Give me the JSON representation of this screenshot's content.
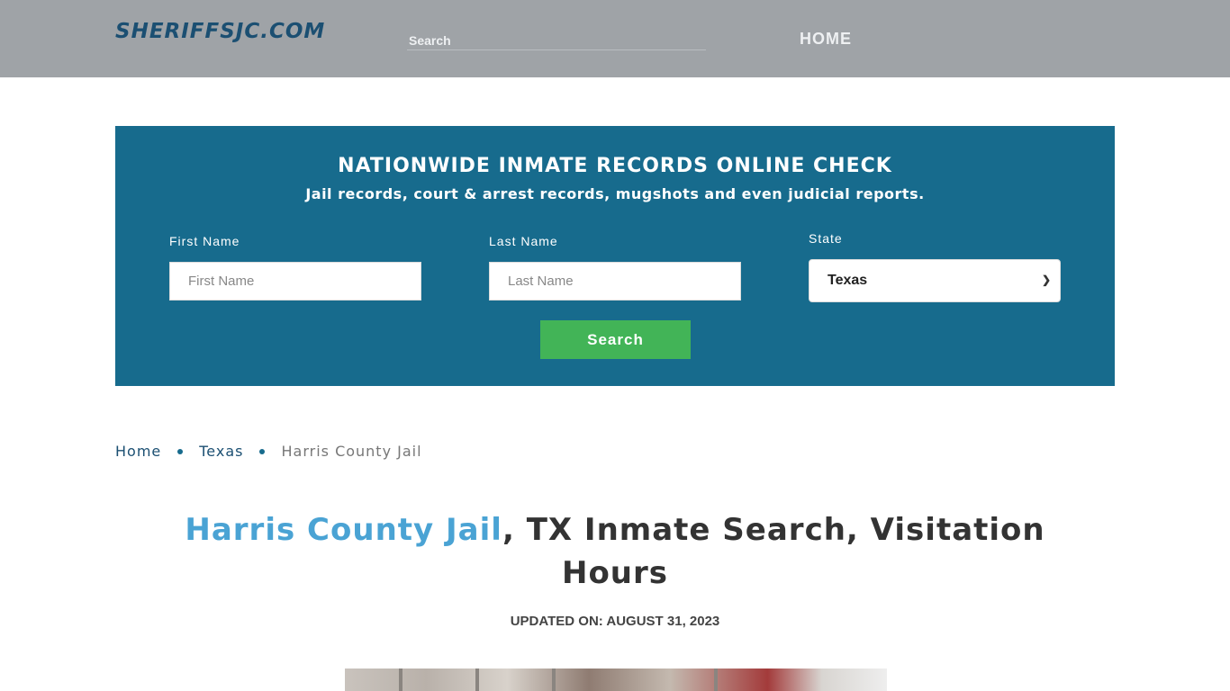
{
  "header": {
    "logo_text": "SHERIFFSJC.COM",
    "search_placeholder": "Search",
    "nav_home": "HOME"
  },
  "search_panel": {
    "title": "NATIONWIDE INMATE RECORDS ONLINE CHECK",
    "subtitle": "Jail records, court & arrest records, mugshots and even judicial reports.",
    "first_name_label": "First Name",
    "first_name_placeholder": "First Name",
    "last_name_label": "Last Name",
    "last_name_placeholder": "Last Name",
    "state_label": "State",
    "state_value": "Texas",
    "search_button": "Search"
  },
  "breadcrumb": {
    "home": "Home",
    "state": "Texas",
    "current": "Harris County Jail"
  },
  "article": {
    "title_highlight": "Harris County Jail",
    "title_rest": ", TX Inmate Search, Visitation Hours",
    "updated": "UPDATED ON: AUGUST 31, 2023"
  },
  "colors": {
    "topbar": "#9fa3a7",
    "panel": "#176b8d",
    "button": "#42b457",
    "highlight": "#4aa3d4"
  }
}
